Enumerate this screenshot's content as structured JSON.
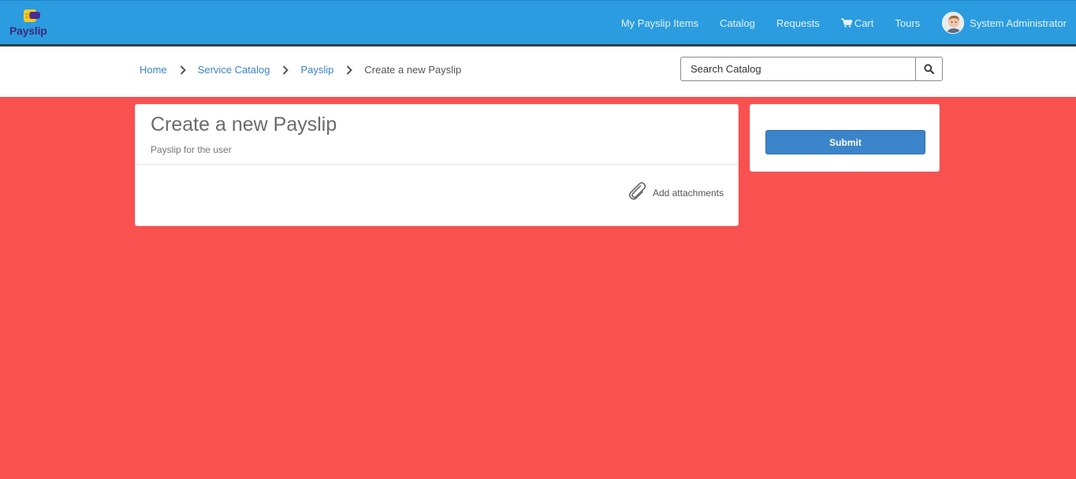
{
  "header": {
    "brand": "Payslip",
    "nav": [
      {
        "label": "My Payslip Items"
      },
      {
        "label": "Catalog"
      },
      {
        "label": "Requests"
      },
      {
        "label": "Cart",
        "icon": "cart-icon"
      },
      {
        "label": "Tours"
      }
    ],
    "user_name": "System Administrator"
  },
  "breadcrumb": {
    "items": [
      "Home",
      "Service Catalog",
      "Payslip"
    ],
    "current": "Create a new Payslip"
  },
  "search": {
    "placeholder": "Search Catalog",
    "icon": "search-icon"
  },
  "form": {
    "title": "Create a new Payslip",
    "subtitle": "Payslip for the user",
    "attach_label": "Add attachments",
    "attach_icon": "paperclip-icon"
  },
  "sidebar": {
    "submit_label": "Submit"
  },
  "colors": {
    "header_bg": "#2b9ce0",
    "page_bg": "#f95050",
    "link": "#3b84c9",
    "button": "#3b84c9"
  }
}
